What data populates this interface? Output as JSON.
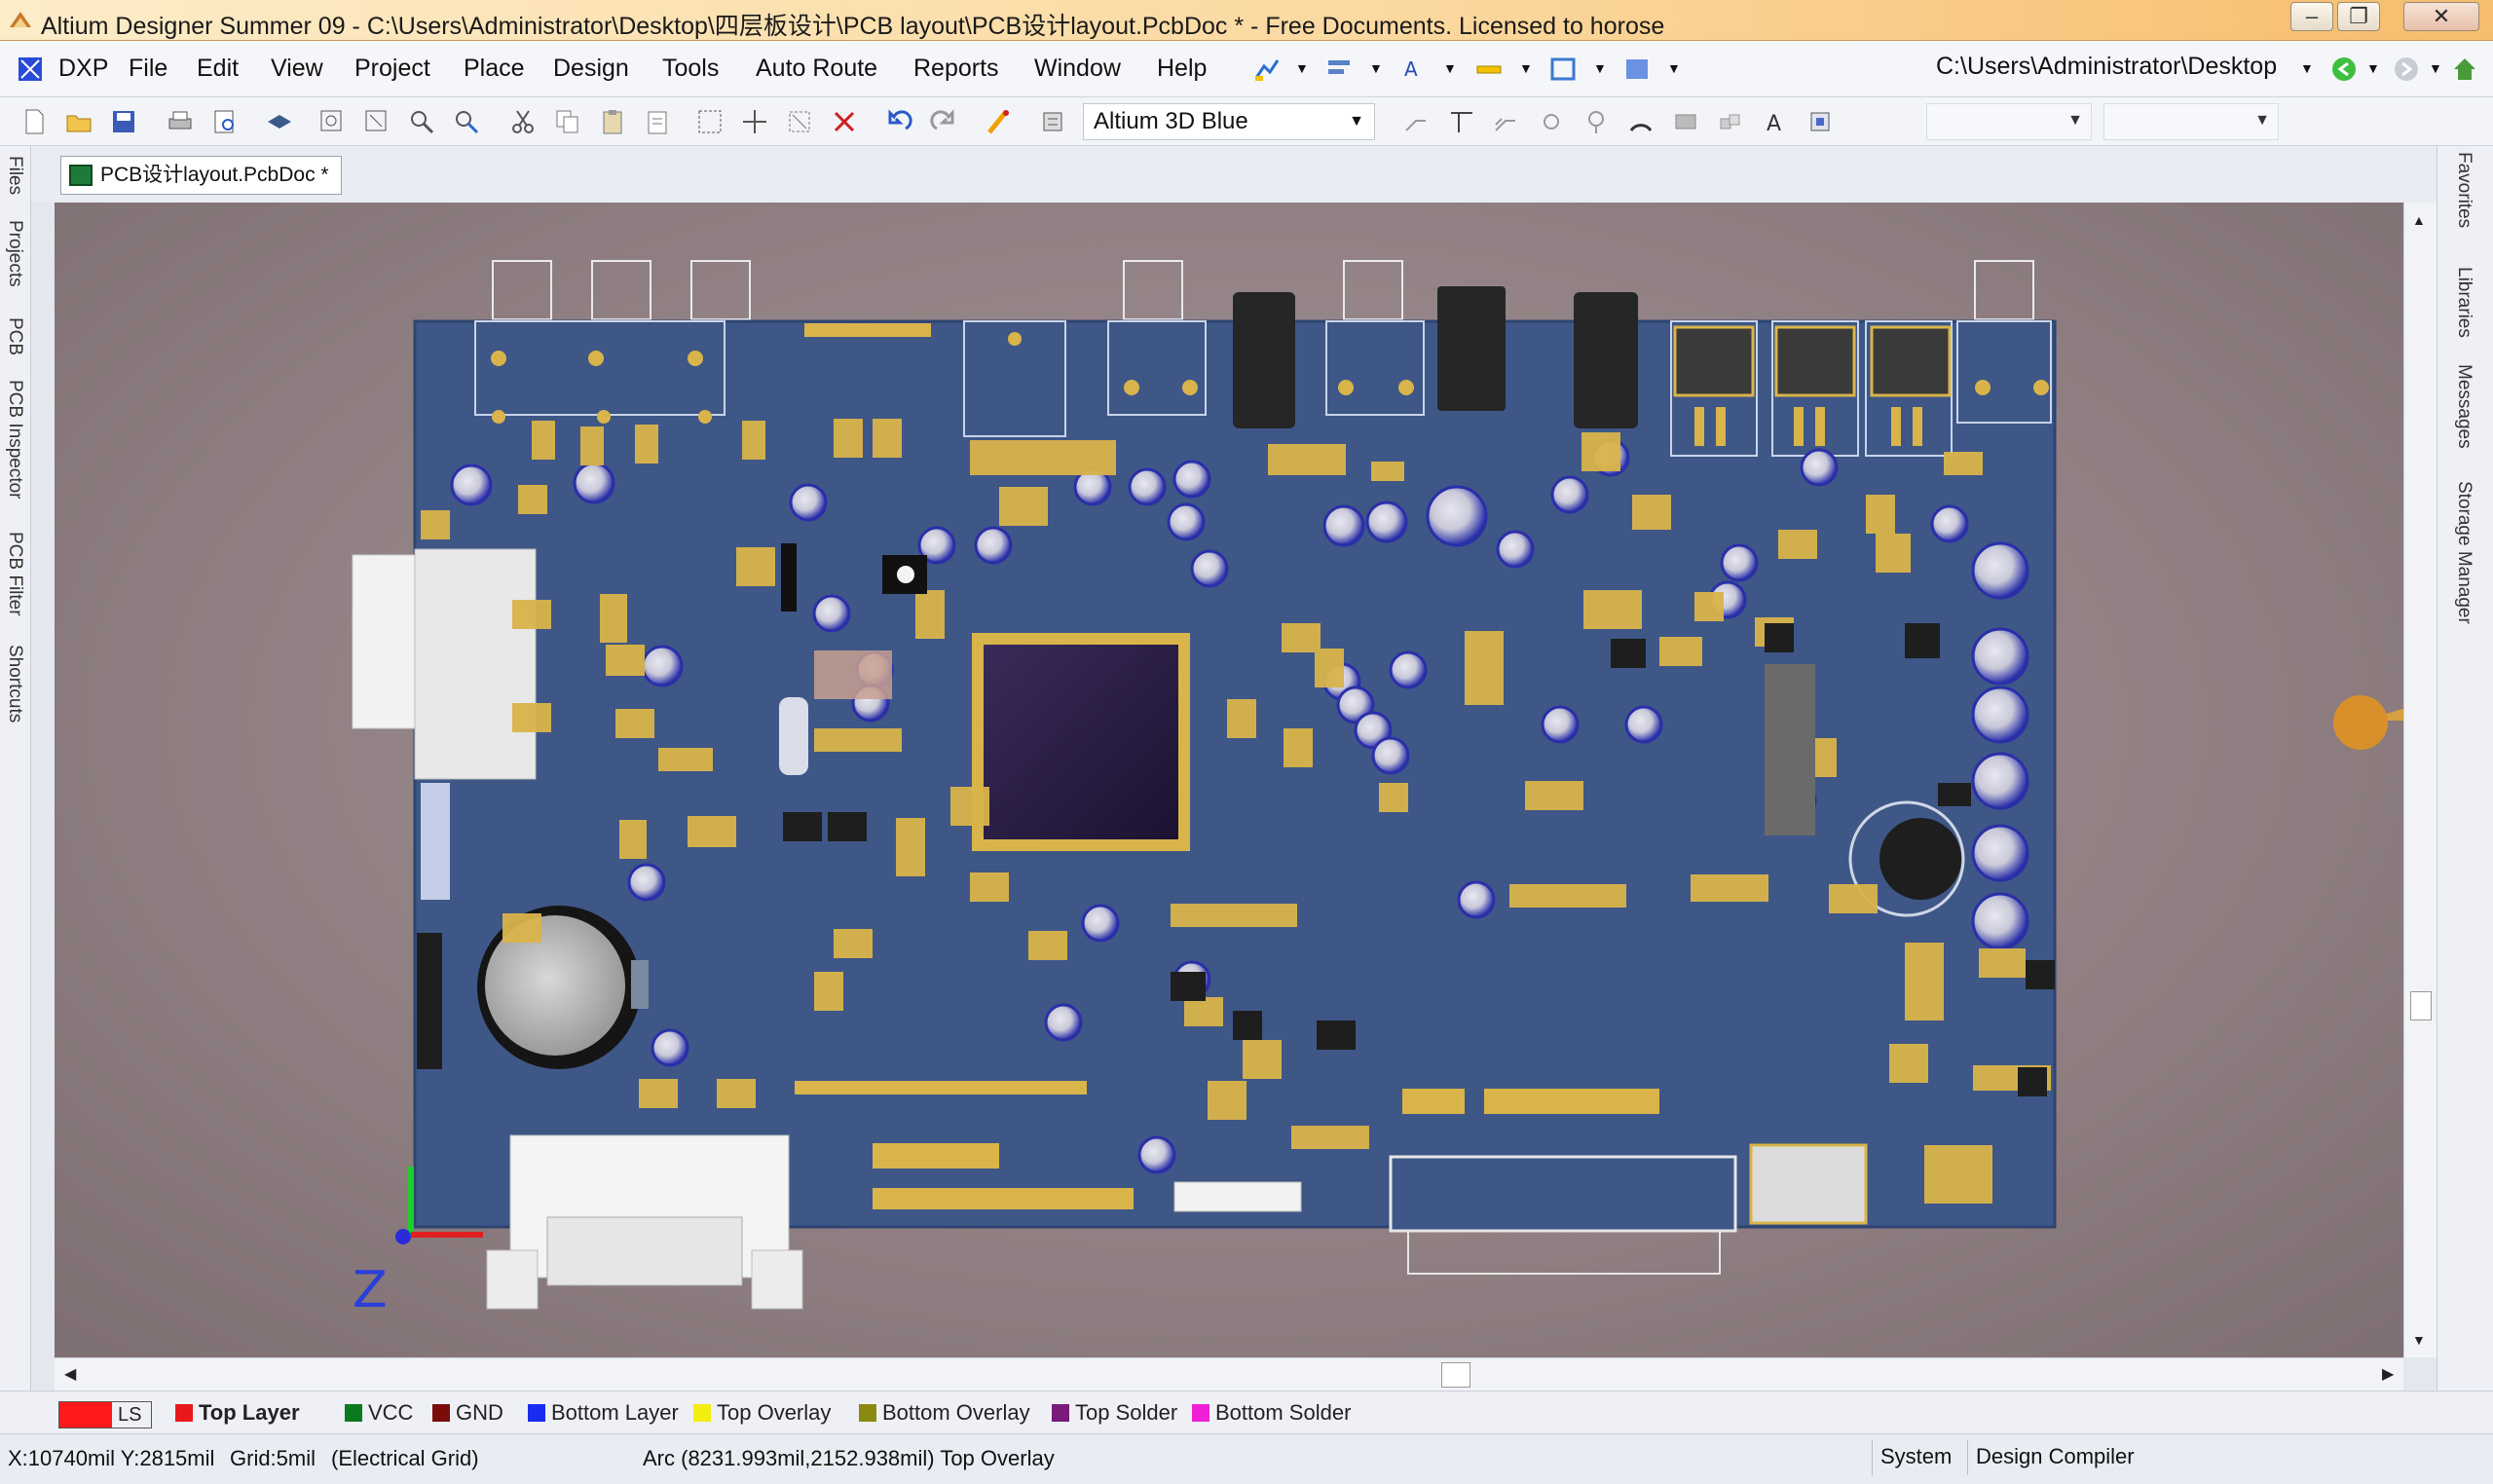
{
  "window": {
    "title": "Altium Designer Summer 09 - C:\\Users\\Administrator\\Desktop\\四层板设计\\PCB layout\\PCB设计layout.PcbDoc * - Free Documents. Licensed to horose",
    "minimize": "–",
    "maximize": "❐",
    "close": "✕"
  },
  "menu": {
    "items": [
      "DXP",
      "File",
      "Edit",
      "View",
      "Project",
      "Place",
      "Design",
      "Tools",
      "Auto Route",
      "Reports",
      "Window",
      "Help"
    ],
    "path": "C:\\Users\\Administrator\\Desktop"
  },
  "toolbar": {
    "view_config": "Altium 3D Blue"
  },
  "document": {
    "tab_label": "PCB设计layout.PcbDoc *"
  },
  "left_panels": [
    "Files",
    "Projects",
    "PCB",
    "PCB Inspector",
    "PCB Filter",
    "Shortcuts"
  ],
  "right_panels": [
    "Favorites",
    "Libraries",
    "Messages",
    "Storage Manager"
  ],
  "canvas": {
    "axis_label": "Z"
  },
  "layers": {
    "ls_label": "LS",
    "tabs": [
      {
        "name": "Top Layer",
        "color": "#e8191c",
        "active": true
      },
      {
        "name": "VCC",
        "color": "#0a7a1e"
      },
      {
        "name": "GND",
        "color": "#7a0c0c"
      },
      {
        "name": "Bottom Layer",
        "color": "#1a2cf0"
      },
      {
        "name": "Top Overlay",
        "color": "#f2ef10"
      },
      {
        "name": "Bottom Overlay",
        "color": "#8a8a10"
      },
      {
        "name": "Top Solder",
        "color": "#7a1a7a"
      },
      {
        "name": "Bottom Solder",
        "color": "#f020d8"
      }
    ]
  },
  "status": {
    "coords": "X:10740mil Y:2815mil",
    "grid": "Grid:5mil",
    "grid_type": "(Electrical Grid)",
    "object_info": "Arc (8231.993mil,2152.938mil)  Top Overlay",
    "system_btn": "System",
    "compiler_btn": "Design Compiler"
  },
  "colors": {
    "board": "#3e5787",
    "canvas_bg": "#8f7f82",
    "gold": "#d9b44a",
    "cap_blue": "#2a2fa8"
  }
}
